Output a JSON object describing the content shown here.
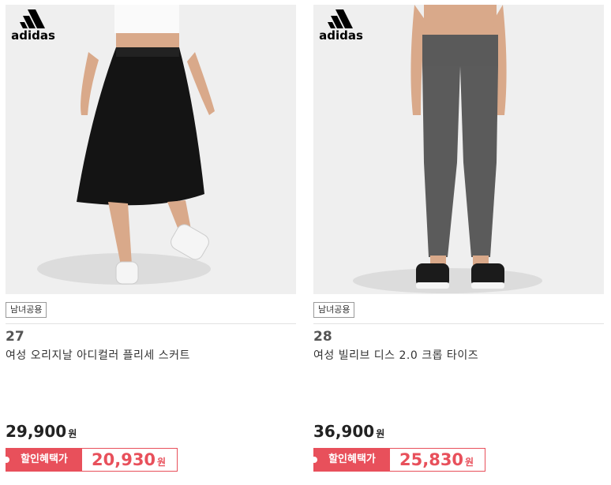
{
  "products": [
    {
      "brand": "adidas",
      "badge": "남녀공용",
      "rank": "27",
      "name": "여성 오리지날 아디컬러 플리세 스커트",
      "price": "29,900",
      "price_unit": "원",
      "discount_label": "할인혜택가",
      "discount_price": "20,930",
      "discount_unit": "원"
    },
    {
      "brand": "adidas",
      "badge": "남녀공용",
      "rank": "28",
      "name": "여성 빌리브 디스 2.0 크롭 타이즈",
      "price": "36,900",
      "price_unit": "원",
      "discount_label": "할인혜택가",
      "discount_price": "25,830",
      "discount_unit": "원"
    }
  ],
  "colors": {
    "accent": "#e8505b",
    "photo_bg": "#efefef"
  }
}
